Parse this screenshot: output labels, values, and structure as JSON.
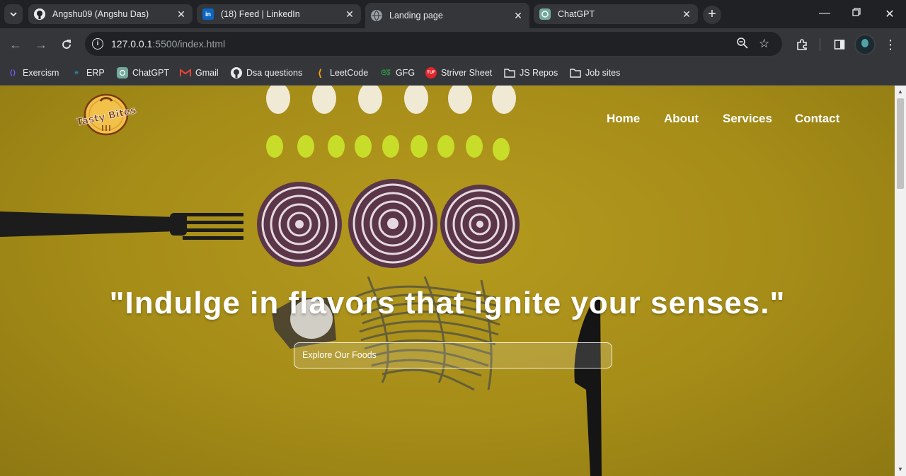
{
  "tabs": [
    {
      "title": "Angshu09 (Angshu Das)",
      "icon": "github-icon"
    },
    {
      "title": "(18) Feed | LinkedIn",
      "icon": "linkedin-icon"
    },
    {
      "title": "Landing page",
      "icon": "globe-icon"
    },
    {
      "title": "ChatGPT",
      "icon": "chatgpt-icon"
    }
  ],
  "address": {
    "host": "127.0.0.1",
    "path": ":5500/index.html"
  },
  "bookmarks": [
    {
      "label": "Exercism"
    },
    {
      "label": "ERP"
    },
    {
      "label": "ChatGPT"
    },
    {
      "label": "Gmail"
    },
    {
      "label": "Dsa questions"
    },
    {
      "label": "LeetCode"
    },
    {
      "label": "GFG"
    },
    {
      "label": "Striver Sheet"
    },
    {
      "label": "JS Repos"
    },
    {
      "label": "Job sites"
    }
  ],
  "site": {
    "logo_text": "Tasty Bites",
    "nav": [
      {
        "label": "Home"
      },
      {
        "label": "About"
      },
      {
        "label": "Services"
      },
      {
        "label": "Contact"
      }
    ],
    "headline": "\"Indulge in flavors that ignite your senses.\"",
    "cta_label": "Explore Our Foods"
  },
  "colors": {
    "background": "#a58c18",
    "chrome_dark": "#202124",
    "chrome_light": "#35363a",
    "text_light": "#e8eaed"
  }
}
